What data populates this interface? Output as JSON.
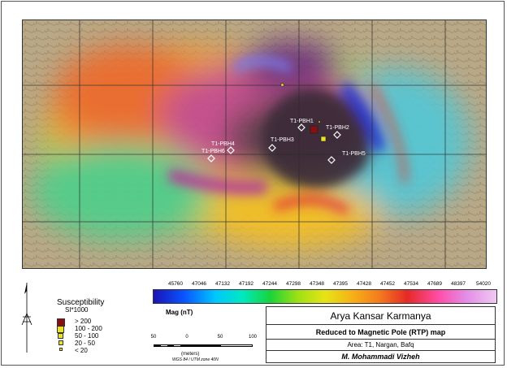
{
  "map": {
    "boreholes": [
      {
        "label": "T1-PBH1"
      },
      {
        "label": "T1-PBH2"
      },
      {
        "label": "T1-PBH3"
      },
      {
        "label": "T1-PBH4"
      },
      {
        "label": "T1-PBH5"
      },
      {
        "label": "T1-PBH6"
      }
    ]
  },
  "susceptibility_legend": {
    "title": "Susceptibility",
    "subtitle": "SI*1000",
    "classes": [
      {
        "label": "> 200",
        "color": "#8b0f10"
      },
      {
        "label": "100 - 200",
        "color": "#e8e22a"
      },
      {
        "label": "50 - 100",
        "color": "#e8e22a"
      },
      {
        "label": "20 - 50",
        "color": "#e8e22a"
      },
      {
        "label": "< 20",
        "color": "#e8e22a"
      }
    ]
  },
  "colorbar": {
    "ticks": [
      "45760",
      "47046",
      "47132",
      "47192",
      "47244",
      "47298",
      "47348",
      "47395",
      "47428",
      "47452",
      "47534",
      "47689",
      "48397",
      "54020"
    ],
    "label": "Mag (nT)"
  },
  "title_block": {
    "company": "Arya Kansar Karmanya",
    "map_title": "Reduced to Magnetic Pole (RTP) map",
    "area": "Area: T1, Nargan, Bafq",
    "author": "M. Mohammadi Vizheh"
  },
  "scale_bar": {
    "labels": [
      "50",
      "0",
      "50",
      "100"
    ],
    "units": "(meters)",
    "projection": "WGS 84 / UTM zone 40N"
  }
}
